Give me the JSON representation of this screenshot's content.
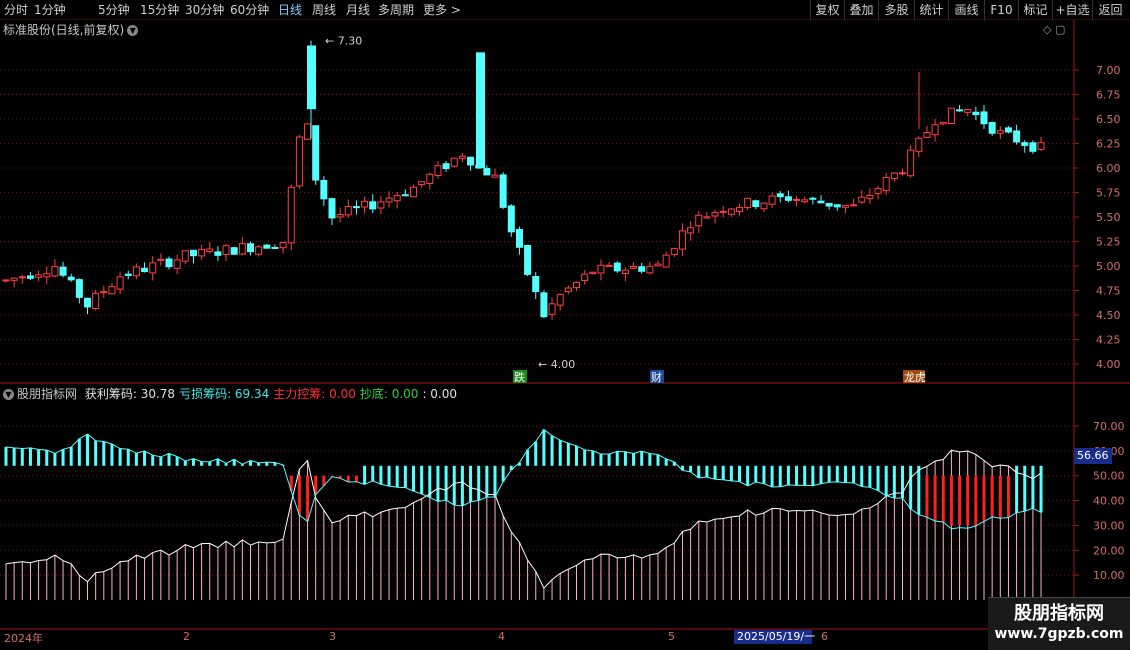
{
  "toolbar": {
    "periods": [
      "分时",
      "1分钟",
      "5分钟",
      "15分钟",
      "30分钟",
      "60分钟",
      "日线",
      "周线",
      "月线",
      "多周期",
      "更多 >"
    ],
    "active_period": "日线",
    "right_buttons": [
      "复权",
      "叠加",
      "多股",
      "统计",
      "画线",
      "F10",
      "标记",
      "+自选",
      "返回"
    ]
  },
  "main_chart": {
    "title": "标准股份(日线,前复权)",
    "high_label": "7.30",
    "low_label": "4.00",
    "y_ticks": [
      "7.00",
      "6.75",
      "6.50",
      "6.25",
      "6.00",
      "5.75",
      "5.50",
      "5.25",
      "5.00",
      "4.75",
      "4.50",
      "4.25",
      "4.00"
    ],
    "event_markers": [
      "跌",
      "财",
      "龙虎"
    ]
  },
  "indicator": {
    "name": "股朋指标网",
    "items": [
      {
        "label": "获利筹码:",
        "value": "30.78",
        "color": "#e0e0e0"
      },
      {
        "label": "亏损筹码:",
        "value": "69.34",
        "color": "#3de8e8"
      },
      {
        "label": "主力控筹:",
        "value": "0.00",
        "color": "#ff3030"
      },
      {
        "label": "抄底:",
        "value": "0.00",
        "color": "#30d030"
      },
      {
        "label": ":",
        "value": "0.00",
        "color": "#e0e0e0"
      }
    ],
    "y_ticks": [
      "70.00",
      "60.00",
      "50.00",
      "40.00",
      "30.00",
      "20.00",
      "10.00"
    ],
    "cursor_value": "56.66"
  },
  "x_axis": {
    "labels": [
      "2024年",
      "2",
      "3",
      "4",
      "5",
      "6"
    ],
    "cursor_date": "2025/05/19/一"
  },
  "watermark": {
    "line1": "股朋指标网",
    "line2": "www.7gpzb.com"
  },
  "colors": {
    "up": "#ff4040",
    "down": "#54ffff",
    "grid": "#7a1010",
    "axis": "#a01818"
  }
}
